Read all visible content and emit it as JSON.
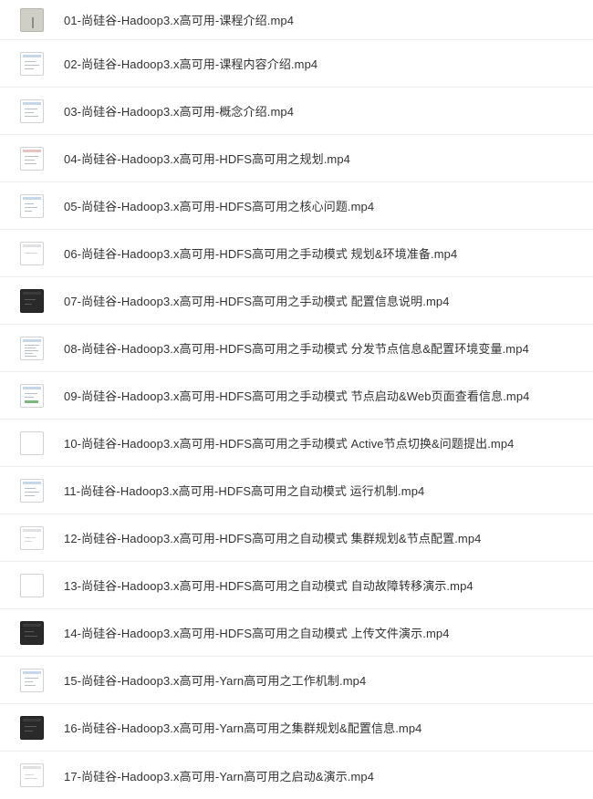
{
  "files": [
    {
      "name": "01-尚硅谷-Hadoop3.x高可用-课程介绍.mp4",
      "thumbnail_icon": "video-thumbnail-icon",
      "thumbnail_style": "gray"
    },
    {
      "name": "02-尚硅谷-Hadoop3.x高可用-课程内容介绍.mp4",
      "thumbnail_icon": "video-thumbnail-icon",
      "thumbnail_style": "light"
    },
    {
      "name": "03-尚硅谷-Hadoop3.x高可用-概念介绍.mp4",
      "thumbnail_icon": "video-thumbnail-icon",
      "thumbnail_style": "light"
    },
    {
      "name": "04-尚硅谷-Hadoop3.x高可用-HDFS高可用之规划.mp4",
      "thumbnail_icon": "video-thumbnail-icon",
      "thumbnail_style": "light"
    },
    {
      "name": "05-尚硅谷-Hadoop3.x高可用-HDFS高可用之核心问题.mp4",
      "thumbnail_icon": "video-thumbnail-icon",
      "thumbnail_style": "light"
    },
    {
      "name": "06-尚硅谷-Hadoop3.x高可用-HDFS高可用之手动模式 规划&环境准备.mp4",
      "thumbnail_icon": "video-thumbnail-icon",
      "thumbnail_style": "light"
    },
    {
      "name": "07-尚硅谷-Hadoop3.x高可用-HDFS高可用之手动模式 配置信息说明.mp4",
      "thumbnail_icon": "video-thumbnail-icon",
      "thumbnail_style": "dark"
    },
    {
      "name": "08-尚硅谷-Hadoop3.x高可用-HDFS高可用之手动模式 分发节点信息&配置环境变量.mp4",
      "thumbnail_icon": "video-thumbnail-icon",
      "thumbnail_style": "light"
    },
    {
      "name": "09-尚硅谷-Hadoop3.x高可用-HDFS高可用之手动模式 节点启动&Web页面查看信息.mp4",
      "thumbnail_icon": "video-thumbnail-icon",
      "thumbnail_style": "light-green"
    },
    {
      "name": "10-尚硅谷-Hadoop3.x高可用-HDFS高可用之手动模式 Active节点切换&问题提出.mp4",
      "thumbnail_icon": "video-thumbnail-icon",
      "thumbnail_style": "blank"
    },
    {
      "name": "11-尚硅谷-Hadoop3.x高可用-HDFS高可用之自动模式 运行机制.mp4",
      "thumbnail_icon": "video-thumbnail-icon",
      "thumbnail_style": "light"
    },
    {
      "name": "12-尚硅谷-Hadoop3.x高可用-HDFS高可用之自动模式 集群规划&节点配置.mp4",
      "thumbnail_icon": "video-thumbnail-icon",
      "thumbnail_style": "light"
    },
    {
      "name": "13-尚硅谷-Hadoop3.x高可用-HDFS高可用之自动模式 自动故障转移演示.mp4",
      "thumbnail_icon": "video-thumbnail-icon",
      "thumbnail_style": "blank"
    },
    {
      "name": "14-尚硅谷-Hadoop3.x高可用-HDFS高可用之自动模式 上传文件演示.mp4",
      "thumbnail_icon": "video-thumbnail-icon",
      "thumbnail_style": "dark"
    },
    {
      "name": "15-尚硅谷-Hadoop3.x高可用-Yarn高可用之工作机制.mp4",
      "thumbnail_icon": "video-thumbnail-icon",
      "thumbnail_style": "light"
    },
    {
      "name": "16-尚硅谷-Hadoop3.x高可用-Yarn高可用之集群规划&配置信息.mp4",
      "thumbnail_icon": "video-thumbnail-icon",
      "thumbnail_style": "dark"
    },
    {
      "name": "17-尚硅谷-Hadoop3.x高可用-Yarn高可用之启动&演示.mp4",
      "thumbnail_icon": "video-thumbnail-icon",
      "thumbnail_style": "light"
    }
  ]
}
